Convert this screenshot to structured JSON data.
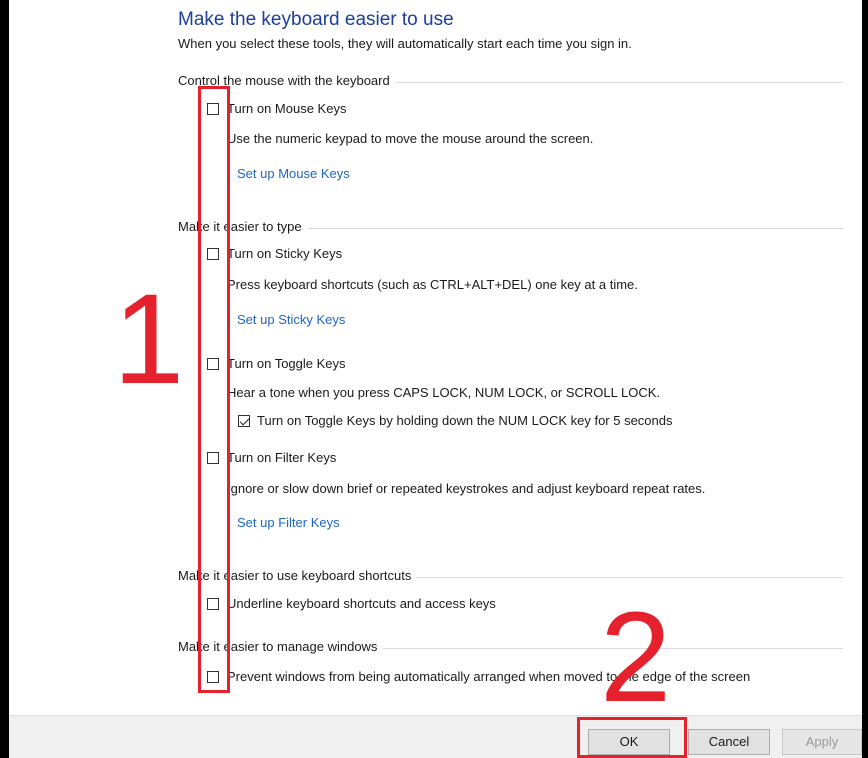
{
  "header": {
    "title": "Make the keyboard easier to use",
    "subtitle": "When you select these tools, they will automatically start each time you sign in."
  },
  "groups": {
    "mouse": {
      "title": "Control the mouse with the keyboard",
      "mouse_keys": {
        "label": "Turn on Mouse Keys",
        "checked": false,
        "description": "Use the numeric keypad to move the mouse around the screen.",
        "link": "Set up Mouse Keys"
      }
    },
    "typing": {
      "title": "Make it easier to type",
      "sticky_keys": {
        "label": "Turn on Sticky Keys",
        "checked": false,
        "description": "Press keyboard shortcuts (such as CTRL+ALT+DEL) one key at a time.",
        "link": "Set up Sticky Keys"
      },
      "toggle_keys": {
        "label": "Turn on Toggle Keys",
        "checked": false,
        "description": "Hear a tone when you press CAPS LOCK, NUM LOCK, or SCROLL LOCK.",
        "sub_option": {
          "label": "Turn on Toggle Keys by holding down the NUM LOCK key for 5 seconds",
          "checked": true
        }
      },
      "filter_keys": {
        "label": "Turn on Filter Keys",
        "checked": false,
        "description": "Ignore or slow down brief or repeated keystrokes and adjust keyboard repeat rates.",
        "link": "Set up Filter Keys"
      }
    },
    "shortcuts": {
      "title": "Make it easier to use keyboard shortcuts",
      "underline": {
        "label": "Underline keyboard shortcuts and access keys",
        "checked": false
      }
    },
    "windows": {
      "title": "Make it easier to manage windows",
      "prevent_arrange": {
        "label": "Prevent windows from being automatically arranged when moved to the edge of the screen",
        "checked": false
      }
    }
  },
  "footer": {
    "ok_label": "OK",
    "cancel_label": "Cancel",
    "apply_label": "Apply",
    "apply_enabled": false
  },
  "annotations": {
    "marker_1": "1",
    "marker_2": "2",
    "color": "#e5212d"
  },
  "colors": {
    "title": "#1e3f9a",
    "link": "#1e66c4"
  }
}
